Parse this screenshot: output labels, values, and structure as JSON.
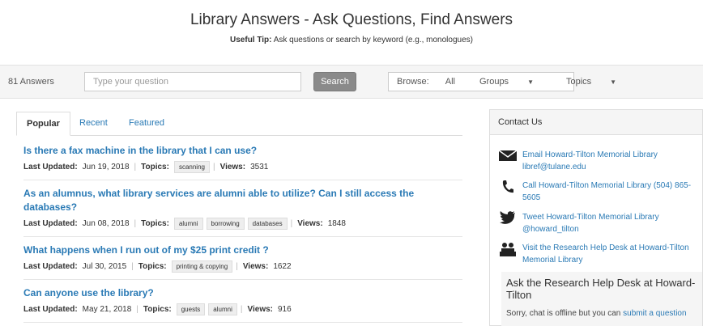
{
  "header": {
    "title": "Library Answers - Ask Questions, Find Answers",
    "tip_label": "Useful Tip:",
    "tip_text": "Ask questions or search by keyword (e.g., monologues)"
  },
  "searchbar": {
    "count": "81 Answers",
    "placeholder": "Type your question",
    "search_label": "Search",
    "browse_label": "Browse:",
    "all_label": "All",
    "groups_label": "Groups",
    "topics_label": "Topics"
  },
  "tabs": [
    "Popular",
    "Recent",
    "Featured"
  ],
  "answers": [
    {
      "question": "Is there a fax machine in the library that I can use?",
      "updated": "Jun 19, 2018",
      "topics": [
        "scanning"
      ],
      "views": "3531"
    },
    {
      "question": "As an alumnus, what library services are alumni able to utilize? Can I still access the databases?",
      "updated": "Jun 08, 2018",
      "topics": [
        "alumni",
        "borrowing",
        "databases"
      ],
      "views": "1848"
    },
    {
      "question": "What happens when I run out of my $25 print credit ?",
      "updated": "Jul 30, 2015",
      "topics": [
        "printing & copying"
      ],
      "views": "1622"
    },
    {
      "question": "Can anyone use the library?",
      "updated": "May 21, 2018",
      "topics": [
        "guests",
        "alumni"
      ],
      "views": "916"
    }
  ],
  "meta_labels": {
    "updated": "Last Updated:",
    "topics": "Topics:",
    "views": "Views:"
  },
  "contact": {
    "heading": "Contact Us",
    "email": "Email Howard-Tilton Memorial Library libref@tulane.edu",
    "call": "Call Howard-Tilton Memorial Library (504) 865-5605",
    "tweet": "Tweet Howard-Tilton Memorial Library @howard_tilton",
    "visit": "Visit the Research Help Desk at Howard-Tilton Memorial Library",
    "ask_title": "Ask the Research Help Desk at Howard-Tilton",
    "ask_text": "Sorry, chat is offline but you can",
    "ask_link": "submit a question"
  },
  "icons": {
    "email": "envelope-icon",
    "call": "phone-icon",
    "tweet": "twitter-bird-icon",
    "visit": "help-desk-icon"
  },
  "colors": {
    "link": "#2a7ab5",
    "search_button": "#8a8a8a"
  }
}
